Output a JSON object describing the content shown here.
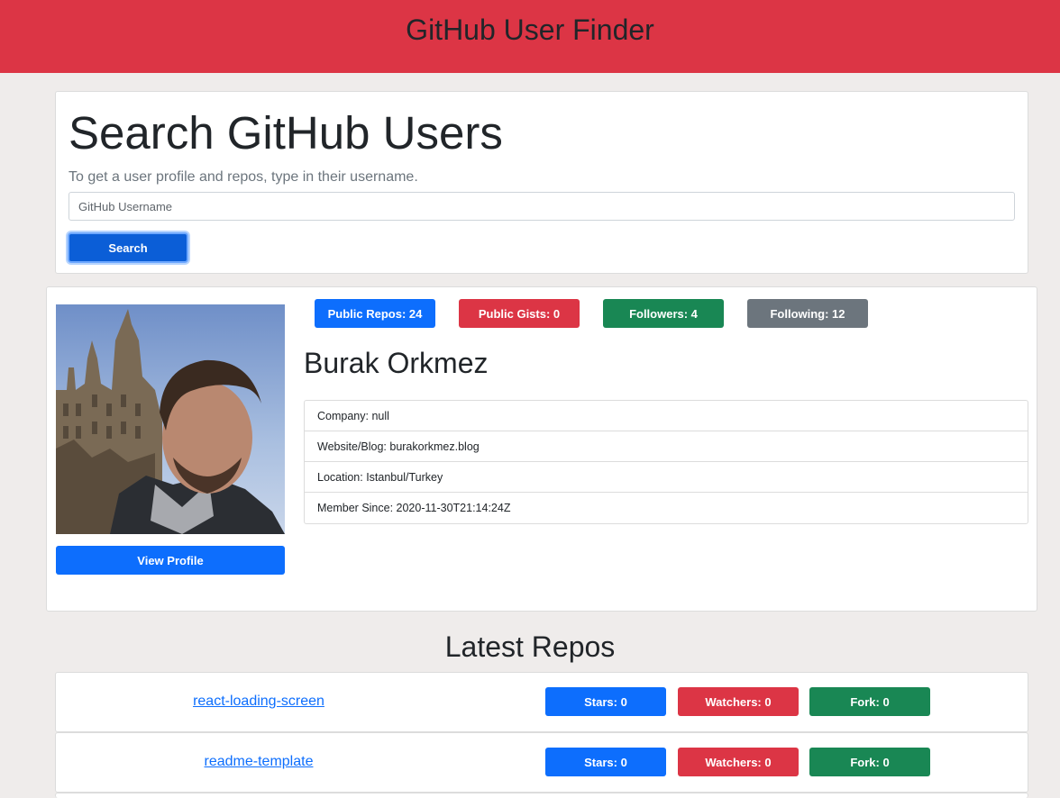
{
  "header": {
    "title": "GitHub User Finder"
  },
  "search": {
    "title": "Search GitHub Users",
    "subtitle": "To get a user profile and repos, type in their username.",
    "placeholder": "GitHub Username",
    "value": "",
    "button_label": "Search"
  },
  "profile": {
    "view_profile_label": "View Profile",
    "badges": {
      "public_repos": "Public Repos: 24",
      "public_gists": "Public Gists: 0",
      "followers": "Followers: 4",
      "following": "Following: 12"
    },
    "name": "Burak Orkmez",
    "details": [
      "Company: null",
      "Website/Blog: burakorkmez.blog",
      "Location: Istanbul/Turkey",
      "Member Since: 2020-11-30T21:14:24Z"
    ]
  },
  "repos": {
    "title": "Latest Repos",
    "items": [
      {
        "name": "react-loading-screen",
        "stars": "Stars: 0",
        "watchers": "Watchers: 0",
        "forks": "Fork: 0"
      },
      {
        "name": "readme-template",
        "stars": "Stars: 0",
        "watchers": "Watchers: 0",
        "forks": "Fork: 0"
      }
    ]
  },
  "colors": {
    "navbar": "#dc3545",
    "primary": "#0d6efd",
    "danger": "#dc3545",
    "success": "#198754",
    "secondary": "#6c757d"
  }
}
